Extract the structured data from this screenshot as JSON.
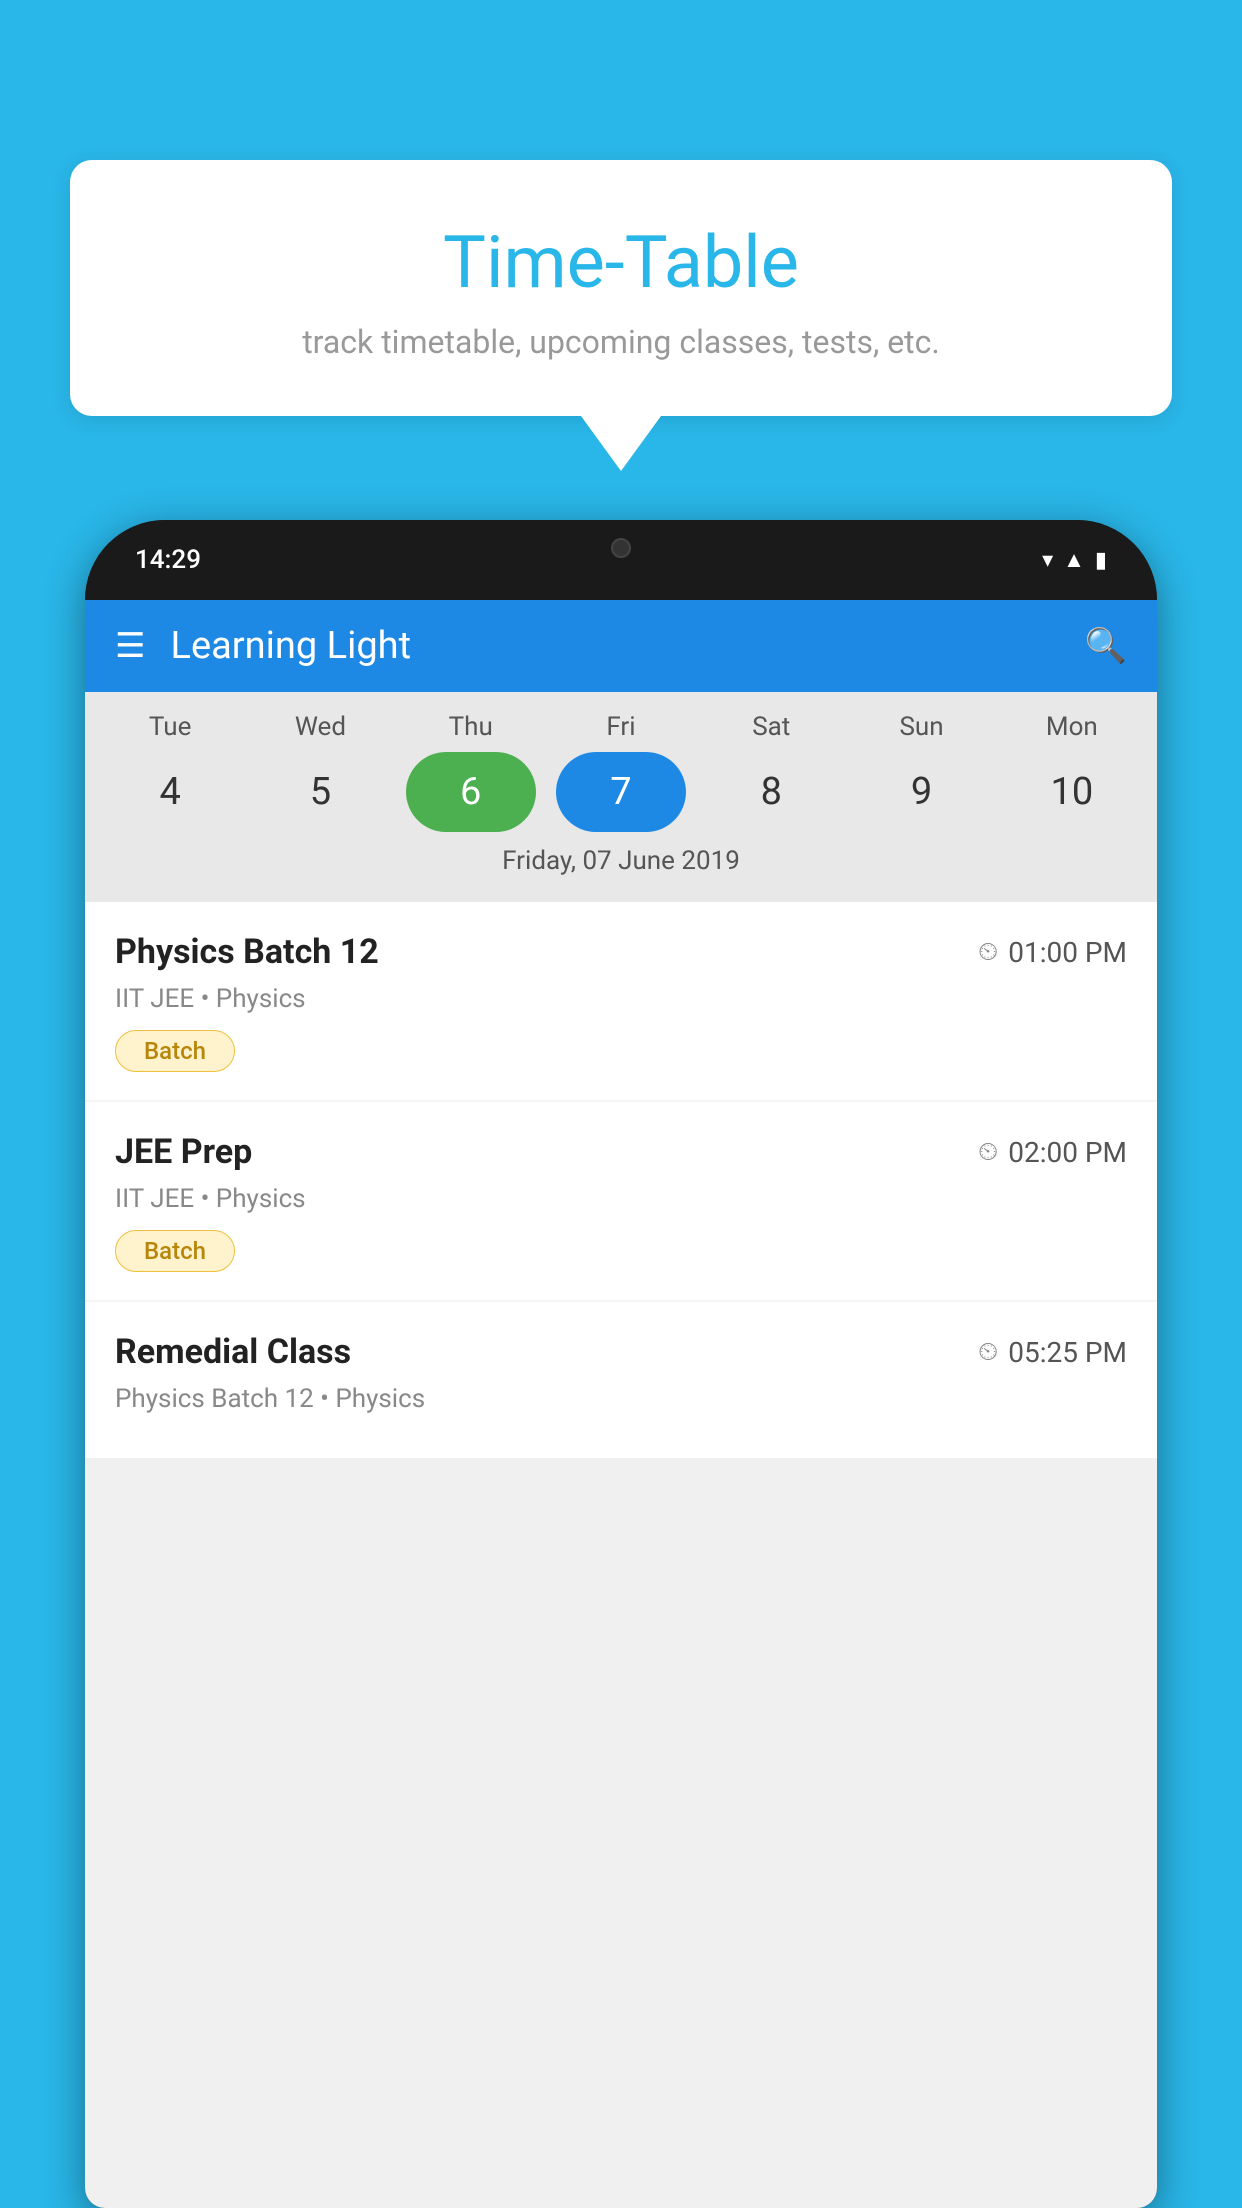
{
  "background": {
    "color": "#29b6e8"
  },
  "speech_bubble": {
    "title": "Time-Table",
    "subtitle": "track timetable, upcoming classes, tests, etc."
  },
  "phone": {
    "status_bar": {
      "time": "14:29",
      "icons": [
        "wifi",
        "signal",
        "battery"
      ]
    },
    "toolbar": {
      "app_title": "Learning Light",
      "menu_icon": "≡",
      "search_icon": "🔍"
    },
    "calendar": {
      "days": [
        {
          "label": "Tue",
          "number": "4"
        },
        {
          "label": "Wed",
          "number": "5"
        },
        {
          "label": "Thu",
          "number": "6",
          "state": "today"
        },
        {
          "label": "Fri",
          "number": "7",
          "state": "selected"
        },
        {
          "label": "Sat",
          "number": "8"
        },
        {
          "label": "Sun",
          "number": "9"
        },
        {
          "label": "Mon",
          "number": "10"
        }
      ],
      "selected_date_label": "Friday, 07 June 2019"
    },
    "schedule": [
      {
        "title": "Physics Batch 12",
        "time": "01:00 PM",
        "subtitle": "IIT JEE • Physics",
        "tag": "Batch"
      },
      {
        "title": "JEE Prep",
        "time": "02:00 PM",
        "subtitle": "IIT JEE • Physics",
        "tag": "Batch"
      },
      {
        "title": "Remedial Class",
        "time": "05:25 PM",
        "subtitle": "Physics Batch 12 • Physics",
        "tag": ""
      }
    ]
  }
}
